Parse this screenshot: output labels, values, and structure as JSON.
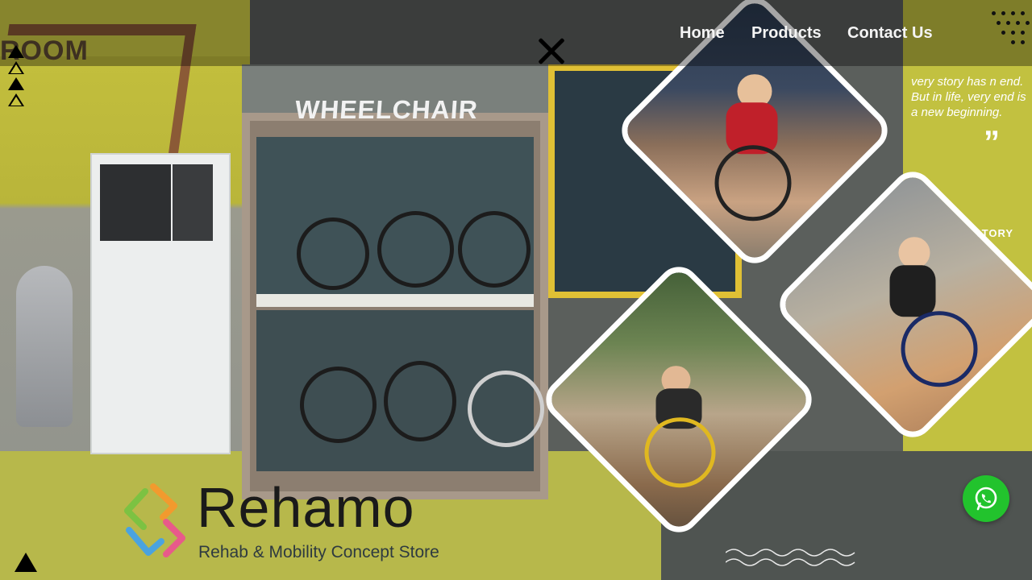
{
  "nav": {
    "links": [
      {
        "label": "Home"
      },
      {
        "label": "Products"
      },
      {
        "label": "Contact Us"
      }
    ]
  },
  "hero": {
    "sign_room": "ROOM",
    "sign_wheelchair": "WHEELCHAIR",
    "story_quote": "very story has n end. But in life, very end is a new beginning.",
    "quote_mark": "”",
    "story_label": "STORY"
  },
  "brand": {
    "name": "Rehamo",
    "tagline": "Rehab & Mobility Concept Store",
    "colors": {
      "orange": "#f29a2e",
      "blue": "#4aa3df",
      "green": "#7cc242",
      "pink": "#e85a8a"
    }
  },
  "icons": {
    "close": "close-icon",
    "whatsapp": "whatsapp-icon"
  },
  "accent_colors": {
    "whatsapp_green": "#22c32d",
    "wall_yellow": "#c6c23e"
  }
}
